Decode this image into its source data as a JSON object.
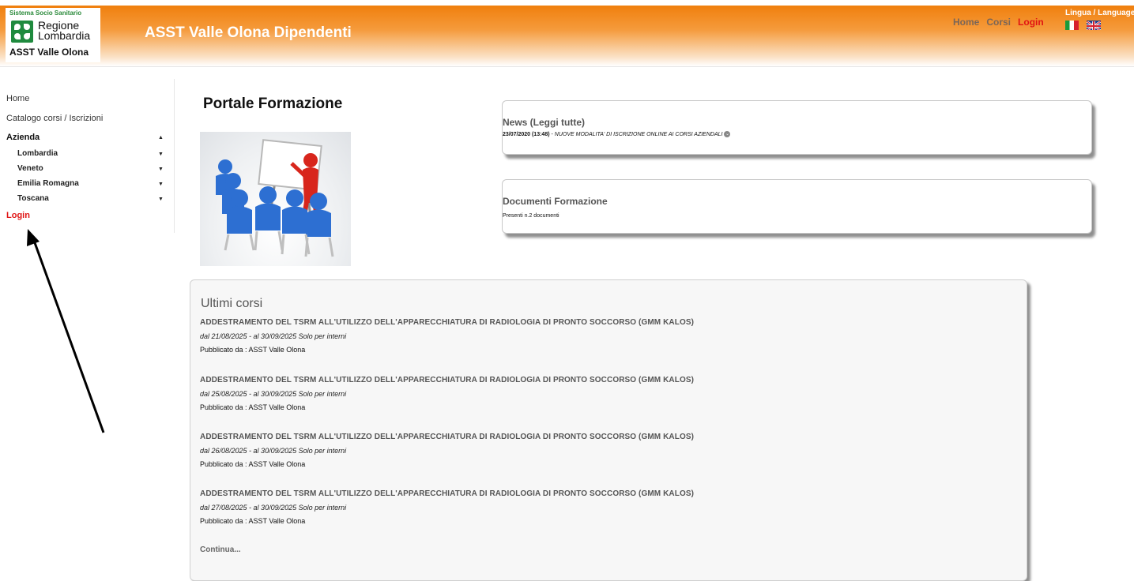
{
  "header": {
    "logo_top": "Sistema Socio Sanitario",
    "logo_name_line1": "Regione",
    "logo_name_line2": "Lombardia",
    "logo_bottom": "ASST Valle Olona",
    "site_title": "ASST Valle Olona Dipendenti",
    "nav": {
      "home": "Home",
      "corsi": "Corsi",
      "login": "Login"
    },
    "language_label": "Lingua / Language",
    "flags": [
      "italian-flag-icon",
      "uk-flag-icon"
    ]
  },
  "sidebar": {
    "items": [
      {
        "label": "Home"
      },
      {
        "label": "Catalogo corsi / Iscrizioni"
      }
    ],
    "azienda": {
      "label": "Azienda",
      "caret": "▲",
      "regions": [
        {
          "label": "Lombardia",
          "caret": "▼"
        },
        {
          "label": "Veneto",
          "caret": "▼"
        },
        {
          "label": "Emilia Romagna",
          "caret": "▼"
        },
        {
          "label": "Toscana",
          "caret": "▼"
        }
      ]
    },
    "login": "Login"
  },
  "main": {
    "page_title": "Portale Formazione",
    "news": {
      "title": "News (Leggi tutte)",
      "date": "23/07/2020 (13:48)",
      "separator": " - ",
      "text": "NUOVE MODALITA' DI ISCRIZIONE ONLINE AI CORSI AZIENDALI",
      "info_icon": "⌄"
    },
    "documents": {
      "title": "Documenti Formazione",
      "text": "Presenti n.2 documenti"
    },
    "courses": {
      "title": "Ultimi corsi",
      "items": [
        {
          "name": "ADDESTRAMENTO DEL TSRM ALL'UTILIZZO DELL'APPARECCHIATURA DI RADIOLOGIA DI PRONTO SOCCORSO (GMM KALOS)",
          "dates": "dal 21/08/2025 - al 30/09/2025 Solo per interni",
          "publisher": "Pubblicato da : ASST Valle Olona"
        },
        {
          "name": "ADDESTRAMENTO DEL TSRM ALL'UTILIZZO DELL'APPARECCHIATURA DI RADIOLOGIA DI PRONTO SOCCORSO (GMM KALOS)",
          "dates": "dal 25/08/2025 - al 30/09/2025 Solo per interni",
          "publisher": "Pubblicato da : ASST Valle Olona"
        },
        {
          "name": "ADDESTRAMENTO DEL TSRM ALL'UTILIZZO DELL'APPARECCHIATURA DI RADIOLOGIA DI PRONTO SOCCORSO (GMM KALOS)",
          "dates": "dal 26/08/2025 - al 30/09/2025 Solo per interni",
          "publisher": "Pubblicato da : ASST Valle Olona"
        },
        {
          "name": "ADDESTRAMENTO DEL TSRM ALL'UTILIZZO DELL'APPARECCHIATURA DI RADIOLOGIA DI PRONTO SOCCORSO (GMM KALOS)",
          "dates": "dal 27/08/2025 - al 30/09/2025 Solo per interni",
          "publisher": "Pubblicato da : ASST Valle Olona"
        }
      ],
      "more": "Continua..."
    }
  },
  "annotation": {
    "arrow_icon": "annotation-arrow"
  },
  "colors": {
    "accent_orange": "#f07f0d",
    "login_red": "#e01414",
    "brand_green": "#1f8a3e"
  }
}
